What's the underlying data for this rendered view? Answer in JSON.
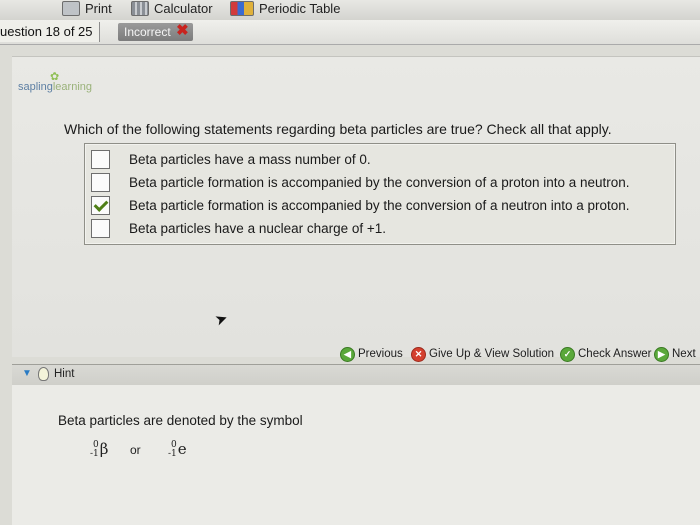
{
  "toolbar": {
    "items": [
      {
        "label": "Print",
        "icon": "printer-icon"
      },
      {
        "label": "Calculator",
        "icon": "calculator-icon"
      },
      {
        "label": "Periodic Table",
        "icon": "periodic-table-icon"
      }
    ]
  },
  "question_bar": {
    "question_number": "uestion 18 of 25",
    "status": "Incorrect",
    "status_icon": "red-x-icon"
  },
  "logo": {
    "part1": "sapling",
    "part2": "learning"
  },
  "question": {
    "prompt": "Which of the following statements regarding beta particles are true? Check all that apply.",
    "options": [
      {
        "text": "Beta particles have a mass number of 0.",
        "checked": false
      },
      {
        "text": "Beta particle formation is accompanied by the conversion of a proton into a neutron.",
        "checked": false
      },
      {
        "text": "Beta particle formation is accompanied by the conversion of a neutron into a proton.",
        "checked": true
      },
      {
        "text": "Beta particles have a nuclear charge of +1.",
        "checked": false
      }
    ]
  },
  "nav": {
    "previous": "Previous",
    "give_up": "Give Up & View Solution",
    "check_answer": "Check Answer",
    "next": "Next"
  },
  "hint": {
    "label": "Hint",
    "text": "Beta particles are denoted by the symbol",
    "symbol1": {
      "top": "0",
      "bottom": "-1",
      "letter": "β"
    },
    "connector": "or",
    "symbol2": {
      "top": "0",
      "bottom": "-1",
      "letter": "e"
    }
  },
  "colors": {
    "logo_blue": "#5d7fa3",
    "logo_green": "#9ab27a",
    "check_green": "#4f7f17",
    "incorrect_red": "#c8231e",
    "hint_arrow_blue": "#2a7bc4"
  }
}
